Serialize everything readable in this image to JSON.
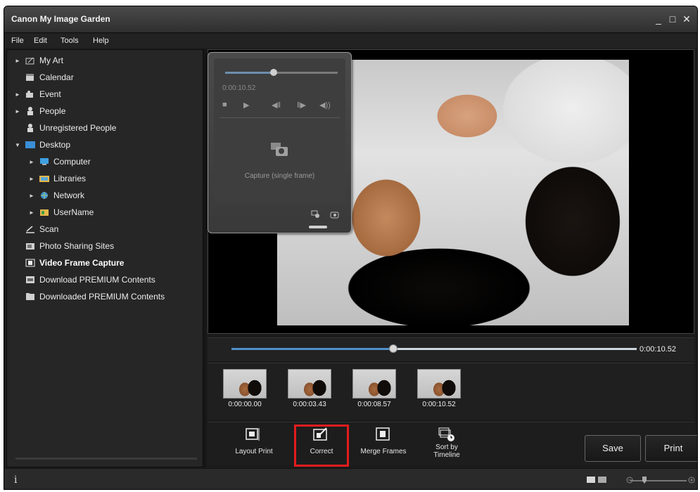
{
  "app": {
    "title": "Canon My Image Garden"
  },
  "window_controls": {
    "minimize": "_",
    "maximize": "□",
    "close": "✕"
  },
  "menu": [
    "File",
    "Edit",
    "Tools",
    "Help"
  ],
  "sidebar": {
    "items": [
      {
        "label": "My Art",
        "arrow": "►",
        "icon": "my-art-icon"
      },
      {
        "label": "Calendar",
        "arrow": "",
        "icon": "calendar-icon"
      },
      {
        "label": "Event",
        "arrow": "►",
        "icon": "event-icon"
      },
      {
        "label": "People",
        "arrow": "►",
        "icon": "people-icon"
      },
      {
        "label": "Unregistered People",
        "arrow": "",
        "icon": "unregistered-people-icon"
      },
      {
        "label": "Desktop",
        "arrow": "▼",
        "icon": "desktop-icon"
      },
      {
        "label": "Computer",
        "arrow": "►",
        "icon": "computer-icon"
      },
      {
        "label": "Libraries",
        "arrow": "►",
        "icon": "libraries-icon"
      },
      {
        "label": "Network",
        "arrow": "►",
        "icon": "network-icon"
      },
      {
        "label": "UserName",
        "arrow": "►",
        "icon": "user-folder-icon"
      },
      {
        "label": "Scan",
        "arrow": "",
        "icon": "scan-icon"
      },
      {
        "label": "Photo Sharing Sites",
        "arrow": "",
        "icon": "photo-sharing-icon"
      },
      {
        "label": "Video Frame Capture",
        "arrow": "",
        "icon": "video-frame-capture-icon"
      },
      {
        "label": "Download PREMIUM Contents",
        "arrow": "",
        "icon": "download-premium-icon"
      },
      {
        "label": "Downloaded PREMIUM Contents",
        "arrow": "",
        "icon": "downloaded-premium-icon"
      }
    ]
  },
  "player": {
    "time": "0:00:10.52",
    "progress": 0.4,
    "capture_label": "Capture (single frame)",
    "progress_popup": 0.43
  },
  "frames": [
    {
      "time": "0:00:00.00"
    },
    {
      "time": "0:00:03.43"
    },
    {
      "time": "0:00:08.57"
    },
    {
      "time": "0:00:10.52"
    }
  ],
  "toolbar": {
    "layout_print": "Layout Print",
    "correct": "Correct",
    "merge_frames": "Merge Frames",
    "sort_by_timeline": "Sort by\nTimeline",
    "save": "Save",
    "print": "Print"
  },
  "status": {
    "info_icon": "i"
  },
  "colors": {
    "accent": "#4f90c8",
    "highlight": "#e31c1c"
  }
}
